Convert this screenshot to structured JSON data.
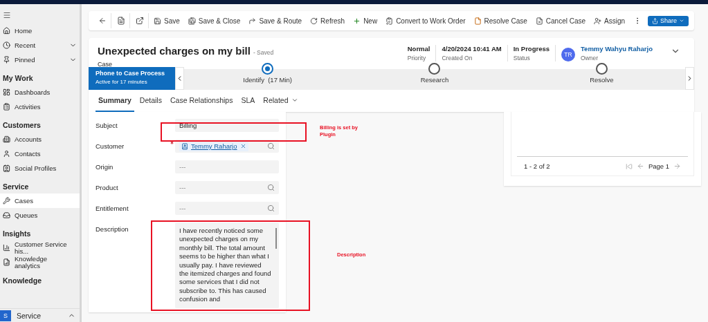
{
  "sidebar": {
    "sections": [
      {
        "items": [
          {
            "label": "Home",
            "selected": false,
            "expandable": false
          },
          {
            "label": "Recent",
            "selected": false,
            "expandable": true
          },
          {
            "label": "Pinned",
            "selected": false,
            "expandable": true
          }
        ]
      },
      {
        "title": "My Work",
        "items": [
          {
            "label": "Dashboards",
            "selected": false,
            "expandable": false
          },
          {
            "label": "Activities",
            "selected": false,
            "expandable": false
          }
        ]
      },
      {
        "title": "Customers",
        "items": [
          {
            "label": "Accounts",
            "selected": false,
            "expandable": false
          },
          {
            "label": "Contacts",
            "selected": false,
            "expandable": false
          },
          {
            "label": "Social Profiles",
            "selected": false,
            "expandable": false
          }
        ]
      },
      {
        "title": "Service",
        "items": [
          {
            "label": "Cases",
            "selected": true,
            "expandable": false
          },
          {
            "label": "Queues",
            "selected": false,
            "expandable": false
          }
        ]
      },
      {
        "title": "Insights",
        "items": [
          {
            "label": "Customer Service his...",
            "selected": false,
            "expandable": false
          },
          {
            "label": "Knowledge analytics",
            "selected": false,
            "expandable": false
          }
        ]
      },
      {
        "title": "Knowledge"
      }
    ],
    "area": {
      "badge": "S",
      "label": "Service"
    }
  },
  "commands": [
    {
      "label": "Save"
    },
    {
      "label": "Save & Close"
    },
    {
      "label": "Save & Route"
    },
    {
      "label": "Refresh"
    },
    {
      "label": "New"
    },
    {
      "label": "Convert to Work Order"
    },
    {
      "label": "Resolve Case"
    },
    {
      "label": "Cancel Case"
    },
    {
      "label": "Assign"
    }
  ],
  "share": {
    "label": "Share"
  },
  "header": {
    "title": "Unexpected charges on my bill",
    "saved_state": "- Saved",
    "entity": "Case",
    "fields": [
      {
        "value": "Normal",
        "label": "Priority"
      },
      {
        "value": "4/20/2024 10:41 AM",
        "label": "Created On"
      },
      {
        "value": "In Progress",
        "label": "Status"
      }
    ],
    "owner": {
      "initials": "TR",
      "name": "Temmy Wahyu Raharjo",
      "label": "Owner"
    }
  },
  "process": {
    "name": "Phone to Case Process",
    "active_for": "Active for 17 minutes",
    "stages": [
      {
        "label": "Identify  (17 Min)",
        "selected": true
      },
      {
        "label": "Research",
        "selected": false
      },
      {
        "label": "Resolve",
        "selected": false
      }
    ]
  },
  "tabs": [
    {
      "label": "Summary",
      "selected": true,
      "dropdown": false
    },
    {
      "label": "Details",
      "selected": false,
      "dropdown": false
    },
    {
      "label": "Case Relationships",
      "selected": false,
      "dropdown": false
    },
    {
      "label": "SLA",
      "selected": false,
      "dropdown": false
    },
    {
      "label": "Related",
      "selected": false,
      "dropdown": true
    }
  ],
  "form": [
    {
      "kind": "text",
      "label": "Subject",
      "value": "Billing",
      "required": false,
      "searchable": false
    },
    {
      "kind": "lookup",
      "label": "Customer",
      "value": "Temmy Raharjo",
      "required": true,
      "searchable": true
    },
    {
      "kind": "text",
      "label": "Origin",
      "placeholder": "---",
      "required": false,
      "searchable": false
    },
    {
      "kind": "text",
      "label": "Product",
      "placeholder": "---",
      "required": false,
      "searchable": true
    },
    {
      "kind": "text",
      "label": "Entitlement",
      "placeholder": "---",
      "required": false,
      "searchable": true
    },
    {
      "kind": "multiline",
      "label": "Description",
      "value": "I have recently noticed some unexpected charges on my monthly bill. The total amount seems to be higher than what I usually pay. I have reviewed the itemized charges and found some services that I did not subscribe to. This has caused confusion and",
      "required": false,
      "searchable": false
    }
  ],
  "pager": {
    "range": "1 - 2 of 2",
    "page": "Page 1"
  },
  "annotations": [
    {
      "text": "Billing is set by Plugin"
    },
    {
      "text": "Description"
    }
  ]
}
